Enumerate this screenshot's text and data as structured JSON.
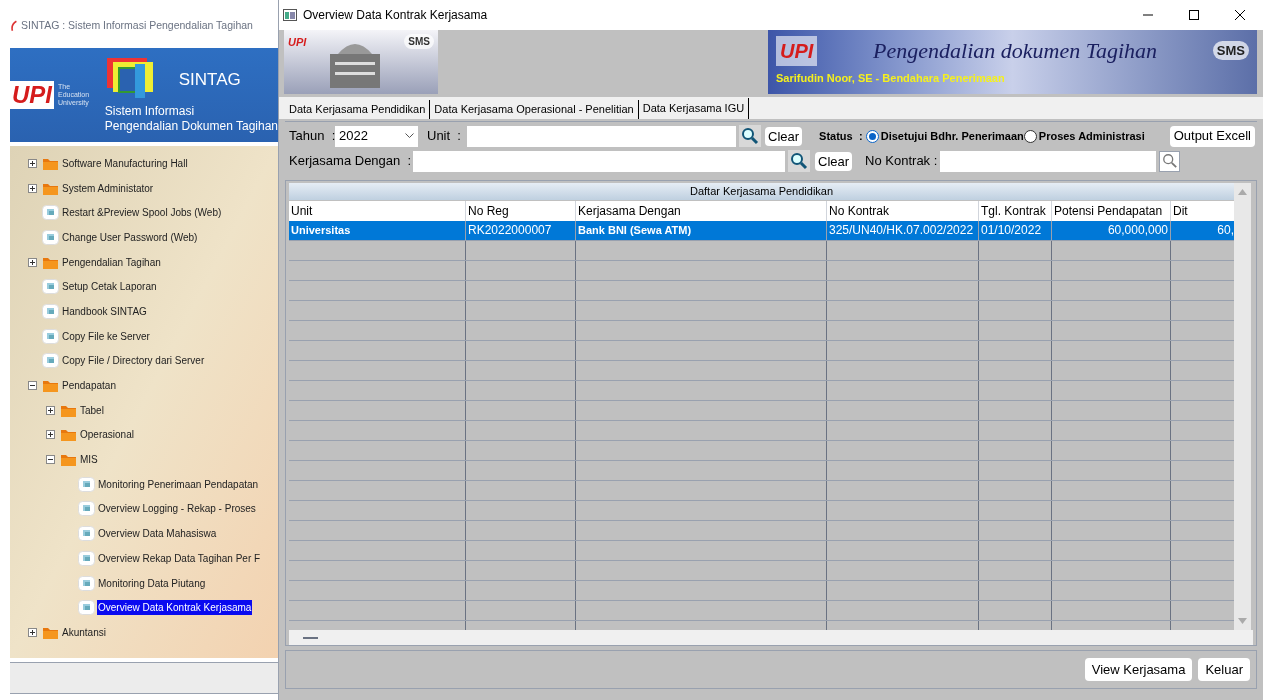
{
  "background_window": {
    "title": "SINTAG : Sistem Informasi Pengendalian Tagihan",
    "banner": {
      "logo": "UPI",
      "logo_tagline": "The Education University",
      "app_name": "SINTAG",
      "subtitle_1": "Sistem Informasi",
      "subtitle_2": "Pengendalian Dokumen Tagihan"
    },
    "tree": [
      {
        "kind": "folder",
        "label": "Software Manufacturing Hall",
        "expanded": false,
        "selected": false
      },
      {
        "kind": "folder",
        "label": "System Administator",
        "expanded": false,
        "selected": false
      },
      {
        "kind": "item",
        "label": "Restart &Preview Spool Jobs (Web)",
        "selected": false
      },
      {
        "kind": "item",
        "label": "Change User Password (Web)",
        "selected": false
      },
      {
        "kind": "folder",
        "label": "Pengendalian Tagihan",
        "expanded": false,
        "selected": false
      },
      {
        "kind": "item",
        "label": "Setup Cetak Laporan",
        "selected": false
      },
      {
        "kind": "item",
        "label": "Handbook SINTAG",
        "selected": false
      },
      {
        "kind": "item",
        "label": "Copy File ke Server",
        "selected": false
      },
      {
        "kind": "item",
        "label": "Copy File / Directory dari Server",
        "selected": false
      },
      {
        "kind": "folder",
        "label": "Pendapatan",
        "expanded": true,
        "selected": false,
        "children": [
          {
            "kind": "folder",
            "label": "Tabel",
            "expanded": false,
            "selected": false
          },
          {
            "kind": "folder",
            "label": "Operasional",
            "expanded": false,
            "selected": false
          },
          {
            "kind": "folder",
            "label": "MIS",
            "expanded": true,
            "selected": false,
            "children": [
              {
                "kind": "item",
                "label": "Monitoring Penerimaan Pendapatan",
                "selected": false
              },
              {
                "kind": "item",
                "label": "Overview Logging - Rekap - Proses",
                "selected": false
              },
              {
                "kind": "item",
                "label": "Overview Data Mahasiswa",
                "selected": false
              },
              {
                "kind": "item",
                "label": "Overview Rekap Data Tagihan Per F",
                "selected": false
              },
              {
                "kind": "item",
                "label": "Monitoring Data Piutang",
                "selected": false
              },
              {
                "kind": "item",
                "label": "Overview Data Kontrak Kerjasama",
                "selected": true
              }
            ]
          }
        ]
      },
      {
        "kind": "folder",
        "label": "Akuntansi",
        "expanded": false,
        "selected": false
      }
    ]
  },
  "window": {
    "title": "Overview Data Kontrak Kerjasama",
    "header_image": {
      "logo_left": "UPI",
      "logo_right": "SMS"
    },
    "banner": {
      "logo_left": "UPI",
      "logo_right": "SMS",
      "heading": "Pengendalian dokumen Tagihan",
      "user": "Sarifudin Noor, SE - Bendahara Penerimaan"
    },
    "tabs": [
      {
        "label": "Data Kerjasama Pendidikan",
        "selected": false
      },
      {
        "label": "Data Kerjasama Operasional - Penelitian",
        "selected": false
      },
      {
        "label": "Data Kerjasama IGU",
        "selected": true
      }
    ],
    "filters": {
      "tahun_label": "Tahun  :",
      "tahun_value": "2022",
      "unit_label": "Unit  :",
      "unit_clear": "Clear",
      "status_label": "Status",
      "status_colon": ":",
      "status_options": [
        {
          "label": "Disetujui Bdhr. Penerimaan",
          "selected": true
        },
        {
          "label": "Proses Administrasi",
          "selected": false
        }
      ],
      "export_button": "Output Excell",
      "partner_label": "Kerjasama Dengan  :",
      "partner_clear": "Clear",
      "contract_label": "No Kontrak :"
    },
    "table": {
      "title": "Daftar  Kerjasama Pendidikan",
      "columns": [
        "Unit",
        "No Reg",
        "Kerjasama Dengan",
        "No Kontrak",
        "Tgl. Kontrak",
        "Potensi Pendapatan",
        "Dit"
      ],
      "rows": [
        {
          "selected": true,
          "cells": [
            "Universitas",
            "RK2022000007",
            "Bank BNI (Sewa ATM)",
            "325/UN40/HK.07.002/2022",
            "01/10/2022",
            "60,000,000",
            "60,"
          ]
        }
      ]
    },
    "buttons": [
      "View Kerjasama",
      "Keluar"
    ]
  }
}
